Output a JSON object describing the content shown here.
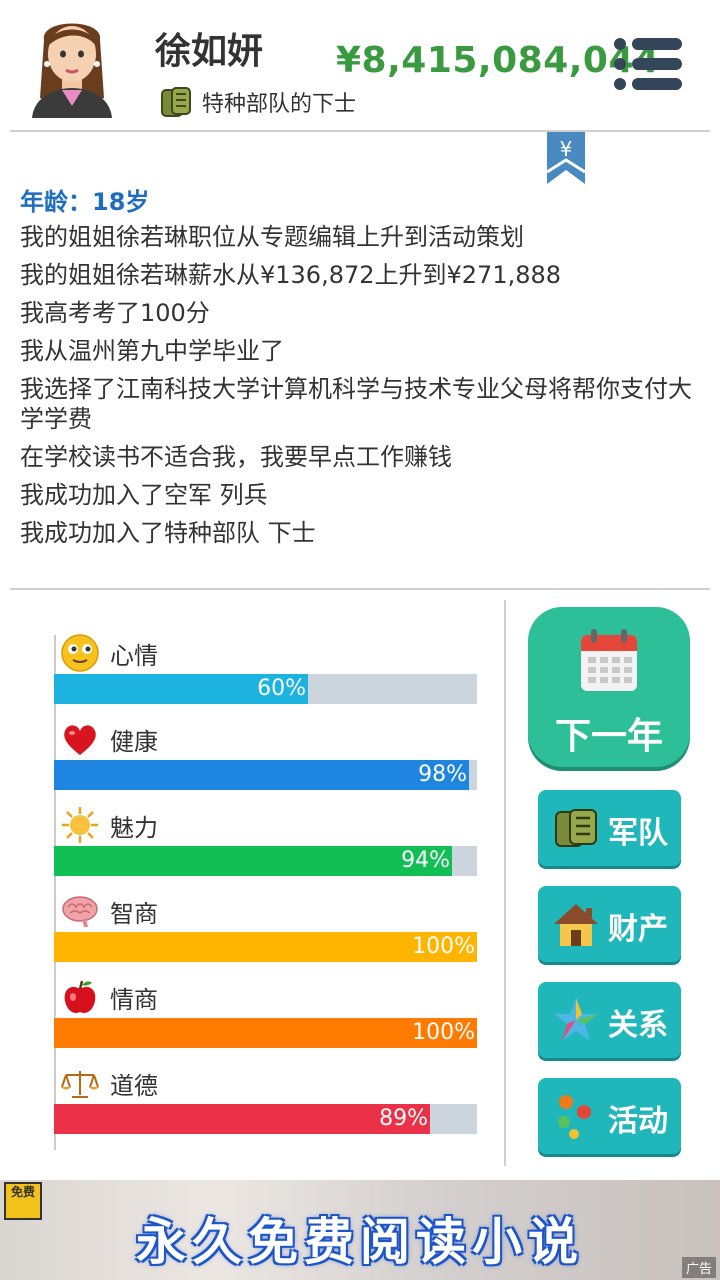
{
  "profile": {
    "name": "徐如妍",
    "rank_title": "特种部队的下士",
    "money": "¥8,415,084,044",
    "avatar_icon": "girl-avatar",
    "rank_icon": "army-rank-icon"
  },
  "log": {
    "age_label": "年龄：18岁",
    "entries": [
      "我的姐姐徐若琳职位从专题编辑上升到活动策划",
      "我的姐姐徐若琳薪水从¥136,872上升到¥271,888",
      "我高考考了100分",
      "我从温州第九中学毕业了",
      "我选择了江南科技大学计算机科学与技术专业父母将帮你支付大学学费",
      "在学校读书不适合我，我要早点工作赚钱",
      "我成功加入了空军 列兵",
      "我成功加入了特种部队 下士"
    ]
  },
  "stats": [
    {
      "label": "心情",
      "value": 60,
      "text": "60%",
      "color": "#1cb3e0",
      "icon": "smiley-icon"
    },
    {
      "label": "健康",
      "value": 98,
      "text": "98%",
      "color": "#1e86e0",
      "icon": "heart-icon"
    },
    {
      "label": "魅力",
      "value": 94,
      "text": "94%",
      "color": "#12bf55",
      "icon": "sun-icon"
    },
    {
      "label": "智商",
      "value": 100,
      "text": "100%",
      "color": "#ffb400",
      "icon": "brain-icon"
    },
    {
      "label": "情商",
      "value": 100,
      "text": "100%",
      "color": "#ff7a00",
      "icon": "apple-icon"
    },
    {
      "label": "道德",
      "value": 89,
      "text": "89%",
      "color": "#eb3147",
      "icon": "scale-icon"
    }
  ],
  "actions": {
    "next_year": "下一年",
    "army": "军队",
    "property": "财产",
    "relations": "关系",
    "activities": "活动"
  },
  "ad": {
    "tag": "免费",
    "headline": "永久免费阅读小说",
    "label": "广告"
  }
}
